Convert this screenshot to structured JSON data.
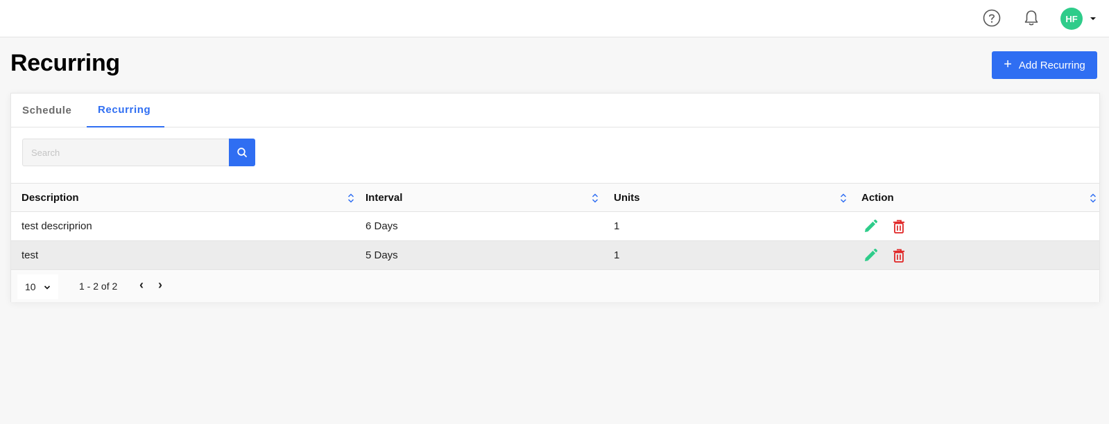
{
  "header": {
    "avatar_initials": "HF",
    "icons": [
      "help-circle-icon",
      "bell-icon",
      "caret-down-icon"
    ]
  },
  "page": {
    "title": "Recurring",
    "add_button_label": "Add Recurring"
  },
  "tabs": [
    {
      "label": "Schedule",
      "active": false
    },
    {
      "label": "Recurring",
      "active": true
    }
  ],
  "search": {
    "placeholder": "Search",
    "value": ""
  },
  "table": {
    "columns": [
      "Description",
      "Interval",
      "Units",
      "Action"
    ],
    "rows": [
      {
        "description": "test descriprion",
        "interval": "6 Days",
        "units": "1"
      },
      {
        "description": "test",
        "interval": "5 Days",
        "units": "1"
      }
    ]
  },
  "pagination": {
    "per_page": "10",
    "range": "1 - 2 of 2",
    "prev": "‹",
    "next": "›"
  },
  "colors": {
    "accent": "#2f6ef2",
    "avatar": "#2ecc8a",
    "edit": "#2ecc8a",
    "delete": "#e02424"
  }
}
